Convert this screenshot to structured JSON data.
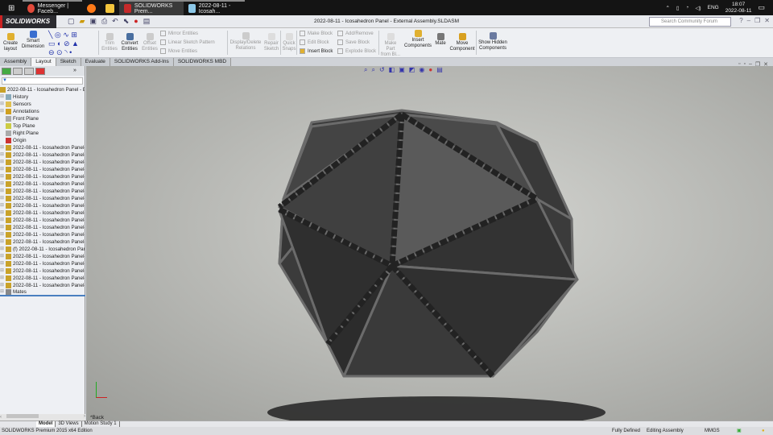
{
  "taskbar": {
    "apps": [
      {
        "label": "Messenger | Faceb...",
        "color": "#e24a3b"
      },
      {
        "label": "",
        "color": "#ff7a18"
      },
      {
        "label": "",
        "color": "#f3c53c"
      },
      {
        "label": "SOLIDWORKS Prem...",
        "color": "#c52a2a"
      },
      {
        "label": "2022-08-11 - Icosah...",
        "color": "#8cc8e8"
      }
    ],
    "lang": "ENG",
    "time": "18:07",
    "date": "2022-08-11"
  },
  "app": {
    "logo": "SOLIDWORKS",
    "title": "2022-08-11 - Icosahedron Panel - External Assembly.SLDASM",
    "search_placeholder": "Search Community Forum"
  },
  "ribbon": {
    "create_layout": "Create layout",
    "smart_dimension": "Smart Dimension",
    "trim": "Trim Entities",
    "convert": "Convert Entities",
    "offset": "Offset Entities",
    "mirror": "Mirror Entities",
    "linear_pattern": "Linear Sketch Pattern",
    "move_entities": "Move Entities",
    "display_delete": "Display/Delete Relations",
    "repair": "Repair Sketch",
    "quick_snaps": "Quick Snaps",
    "make_block": "Make Block",
    "edit_block": "Edit Block",
    "insert_block": "Insert Block",
    "add_remove": "Add/Remove",
    "save_block": "Save Block",
    "explode_block": "Explode Block",
    "make_part": "Make Part from Bl...",
    "insert_components": "Insert Components",
    "mate": "Mate",
    "move_component": "Move Component",
    "show_hidden": "Show Hidden Components"
  },
  "tabs": [
    "Assembly",
    "Layout",
    "Sketch",
    "Evaluate",
    "SOLIDWORKS Add-Ins",
    "SOLIDWORKS MBD"
  ],
  "tree": {
    "root": "2022-08-11 - Icosahedron Panel - External Assembly",
    "features": [
      "History",
      "Sensors",
      "Annotations",
      "Front Plane",
      "Top Plane",
      "Right Plane",
      "Origin"
    ],
    "components": [
      "2022-08-11 - Icosahedron Panel-",
      "2022-08-11 - Icosahedron Panel-",
      "2022-08-11 - Icosahedron Panel-",
      "2022-08-11 - Icosahedron Panel-",
      "2022-08-11 - Icosahedron Panel-",
      "2022-08-11 - Icosahedron Panel-",
      "2022-08-11 - Icosahedron Panel-",
      "2022-08-11 - Icosahedron Panel-",
      "2022-08-11 - Icosahedron Panel-",
      "2022-08-11 - Icosahedron Panel-",
      "2022-08-11 - Icosahedron Panel-",
      "2022-08-11 - Icosahedron Panel-",
      "2022-08-11 - Icosahedron Panel-",
      "2022-08-11 - Icosahedron Panel-",
      "(f) 2022-08-11 - Icosahedron Panel",
      "2022-08-11 - Icosahedron Panel-",
      "2022-08-11 - Icosahedron Panel-",
      "2022-08-11 - Icosahedron Panel-",
      "2022-08-11 - Icosahedron Panel-",
      "2022-08-11 - Icosahedron Panel-"
    ],
    "mates": "Mates"
  },
  "viewport": {
    "view_label": "*Back"
  },
  "bottom_tabs": [
    "Model",
    "3D Views",
    "Motion Study 1"
  ],
  "status": {
    "edition": "SOLIDWORKS Premium 2015 x64 Edition",
    "defined": "Fully Defined",
    "mode": "Editing Assembly",
    "units": "MMGS"
  }
}
